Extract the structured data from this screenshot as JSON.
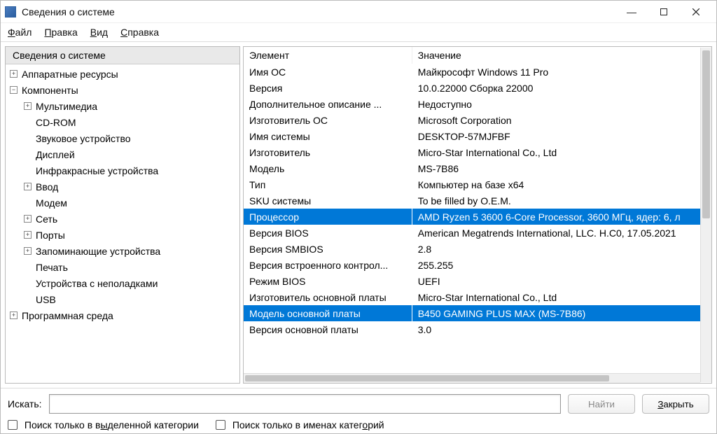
{
  "window": {
    "title": "Сведения о системе"
  },
  "menu": {
    "file": "Файл",
    "edit": "Правка",
    "view": "Вид",
    "help": "Справка"
  },
  "nav": {
    "root": "Сведения о системе",
    "items": [
      {
        "label": "Аппаратные ресурсы",
        "level": 0,
        "toggle": "+"
      },
      {
        "label": "Компоненты",
        "level": 0,
        "toggle": "−"
      },
      {
        "label": "Мультимедиа",
        "level": 1,
        "toggle": "+"
      },
      {
        "label": "CD-ROM",
        "level": 1
      },
      {
        "label": "Звуковое устройство",
        "level": 1
      },
      {
        "label": "Дисплей",
        "level": 1
      },
      {
        "label": "Инфракрасные устройства",
        "level": 1
      },
      {
        "label": "Ввод",
        "level": 1,
        "toggle": "+"
      },
      {
        "label": "Модем",
        "level": 1
      },
      {
        "label": "Сеть",
        "level": 1,
        "toggle": "+"
      },
      {
        "label": "Порты",
        "level": 1,
        "toggle": "+"
      },
      {
        "label": "Запоминающие устройства",
        "level": 1,
        "toggle": "+"
      },
      {
        "label": "Печать",
        "level": 1
      },
      {
        "label": "Устройства с неполадками",
        "level": 1
      },
      {
        "label": "USB",
        "level": 1
      },
      {
        "label": "Программная среда",
        "level": 0,
        "toggle": "+"
      }
    ]
  },
  "details": {
    "headers": {
      "element": "Элемент",
      "value": "Значение"
    },
    "rows": [
      {
        "e": "Имя ОС",
        "v": "Майкрософт Windows 11 Pro"
      },
      {
        "e": "Версия",
        "v": "10.0.22000 Сборка 22000"
      },
      {
        "e": "Дополнительное описание ...",
        "v": "Недоступно"
      },
      {
        "e": "Изготовитель ОС",
        "v": "Microsoft Corporation"
      },
      {
        "e": "Имя системы",
        "v": "DESKTOP-57MJFBF"
      },
      {
        "e": "Изготовитель",
        "v": "Micro-Star International Co., Ltd"
      },
      {
        "e": "Модель",
        "v": "MS-7B86"
      },
      {
        "e": "Тип",
        "v": "Компьютер на базе x64"
      },
      {
        "e": "SKU системы",
        "v": "To be filled by O.E.M."
      },
      {
        "e": "Процессор",
        "v": "AMD Ryzen 5 3600 6-Core Processor, 3600 МГц, ядер: 6, л",
        "sel": true
      },
      {
        "e": "Версия BIOS",
        "v": "American Megatrends International, LLC. H.C0, 17.05.2021"
      },
      {
        "e": "Версия SMBIOS",
        "v": "2.8"
      },
      {
        "e": "Версия встроенного контрол...",
        "v": "255.255"
      },
      {
        "e": "Режим BIOS",
        "v": "UEFI"
      },
      {
        "e": "Изготовитель основной платы",
        "v": "Micro-Star International Co., Ltd"
      },
      {
        "e": "Модель основной платы",
        "v": "B450 GAMING PLUS MAX (MS-7B86)",
        "sel": true
      },
      {
        "e": "Версия основной платы",
        "v": "3.0"
      }
    ]
  },
  "search": {
    "label": "Искать:",
    "find": "Найти",
    "close": "Закрыть",
    "chk1_pre": "Поиск только в в",
    "chk1_u": "ы",
    "chk1_post": "деленной категории",
    "chk2_pre": "Поиск только в именах катег",
    "chk2_u": "о",
    "chk2_post": "рий"
  }
}
